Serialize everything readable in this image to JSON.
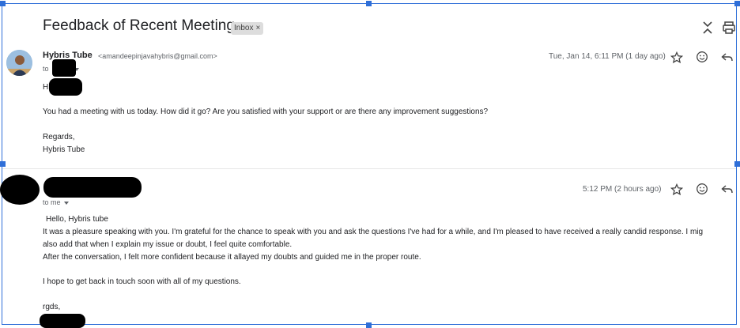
{
  "thread": {
    "subject": "Feedback of Recent Meeting",
    "label_chip": "Inbox",
    "label_chip_close": "×"
  },
  "icons": {
    "expand": "expand-collapse-icon",
    "print": "print-icon",
    "star": "star-icon",
    "emoji": "emoji-reaction-icon",
    "reply": "reply-icon",
    "avatar": "avatar-photo"
  },
  "message1": {
    "sender_name": "Hybris Tube",
    "sender_email": "<amandeepinjavahybris@gmail.com>",
    "to_prefix": "to",
    "timestamp": "Tue, Jan 14, 6:11 PM (1 day ago)",
    "greeting": "Hi",
    "line1": "You had a meeting with us today. How did it go? Are you satisfied with your support or are there any improvement suggestions?",
    "signoff": "Regards,",
    "signature": "Hybris Tube"
  },
  "message2": {
    "to_line": "to me",
    "timestamp": "5:12 PM (2 hours ago)",
    "greeting": "Hello, Hybris tube",
    "line1": "It was a pleasure speaking with you. I'm grateful for the chance to speak with you and ask the questions I've had for a while, and I'm pleased to have received a really candid response. I mig",
    "line2": "also add that when I explain my issue or doubt, I feel quite comfortable.",
    "line3": "After the conversation, I felt more confident because it allayed my doubts and guided me in the proper route.",
    "line4": "I hope to get back in touch soon with all of my questions.",
    "signoff": "rgds,"
  },
  "colors": {
    "selection_border": "#2f6fd8",
    "text_primary": "#202124",
    "text_secondary": "#5f6368",
    "chip_bg": "#dddddd",
    "redaction": "#000000"
  }
}
